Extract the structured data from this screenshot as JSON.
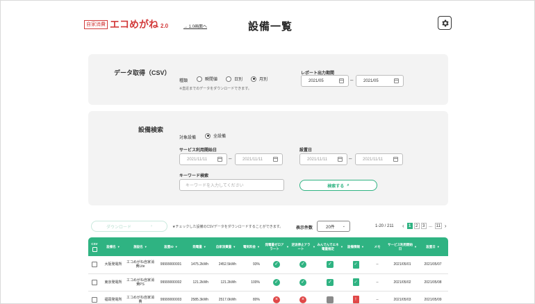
{
  "header": {
    "logo_badge": "自家消費",
    "logo_main": "エコめがね",
    "logo_version": "2.0",
    "v1_link": "→ 1.0画面へ",
    "title": "設備一覧",
    "settings_icon": "gear-icon"
  },
  "csv": {
    "title": "データ取得（CSV）",
    "period_label": "種類",
    "options": [
      "瞬間値",
      "日別",
      "月別"
    ],
    "selected": "月別",
    "note": "※直近までのデータをダウンロードできます。",
    "report_label": "レポート出力期間",
    "from": "2021/05",
    "to": "2021/05"
  },
  "search": {
    "title": "設備検索",
    "target_label": "対象設備",
    "target_option": "全設備",
    "service_label": "サービス利用開始日",
    "service_from": "2021/11/11",
    "service_to": "2021/11/11",
    "install_label": "設置日",
    "install_from": "2021/11/11",
    "install_to": "2021/11/11",
    "keyword_label": "キーワード検索",
    "keyword_placeholder": "キーワードを入力してください",
    "search_button": "検索する"
  },
  "list": {
    "download_button": "ダウンロード",
    "download_note": "★チェックした設備のCSVデータをダウンロードすることができます。",
    "count_label": "表示件数",
    "count_value": "20件",
    "range": "1-20 / 211",
    "pages": [
      "1",
      "2",
      "3",
      "...",
      "11"
    ],
    "current_page": "1"
  },
  "table": {
    "columns": [
      "CSV",
      "設備名",
      "施設名",
      "設置ID",
      "発電量",
      "自家消費量",
      "電気料金",
      "発電量ゼロアラート",
      "逆流停止アラート",
      "みんでんでエネ電量推定",
      "設備情報",
      "メモ",
      "サービス利用開始日",
      "設置日"
    ],
    "rows": [
      {
        "equipment": "大阪発電所",
        "facility": "エコめがね自家消費Lite",
        "id": "99999000001",
        "generation": "1475.2kWh",
        "self": "2452.5kWh",
        "fee": "93%",
        "zero": "ok",
        "reverse": "ok",
        "estimate": "ok",
        "info": "ok",
        "memo": "--",
        "service": "2021/05/01",
        "install": "2021/05/07"
      },
      {
        "equipment": "東京発電所",
        "facility": "エコめがね自家消費PS",
        "id": "99999000002",
        "generation": "121.2kWh",
        "self": "121.2kWh",
        "fee": "100%",
        "zero": "ok",
        "reverse": "ok",
        "estimate": "ok",
        "info": "ok",
        "memo": "--",
        "service": "2021/05/02",
        "install": "2021/05/08"
      },
      {
        "equipment": "福岡発電所",
        "facility": "エコめがね自家消費",
        "id": "99999000003",
        "generation": "2585.3kWh",
        "self": "2517.0kWh",
        "fee": "80%",
        "zero": "ng",
        "reverse": "ng",
        "estimate": "none",
        "info": "ng",
        "memo": "--",
        "service": "2021/05/03",
        "install": "2021/05/09"
      }
    ]
  },
  "colors": {
    "accent": "#2fb382",
    "alert": "#e04848",
    "logo": "#d23b3b"
  }
}
